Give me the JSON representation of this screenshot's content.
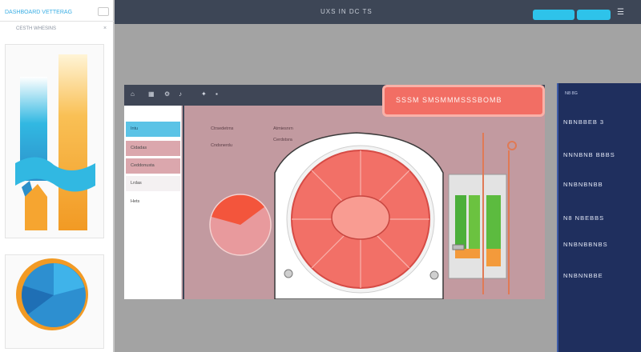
{
  "topbar": {
    "title": "UXS IN DC TS",
    "primary_button": "",
    "secondary_button": ""
  },
  "left_panel": {
    "app_title": "DASHBOARD VETTERAG",
    "subtitle": "CESTH WHESINS",
    "close_glyph": "×"
  },
  "main_window": {
    "alert_text": "SSSM SMSMMMSSSBOMB",
    "sidebar_items": [
      {
        "label": "Intu"
      },
      {
        "label": "Cidadas"
      },
      {
        "label": "Ceddonusta"
      },
      {
        "label": "Lrdas"
      },
      {
        "label": "Hets"
      }
    ],
    "content_lines": [
      "Ctrsedetrns",
      "Atmiesnrn",
      "Cndsnerdu",
      "Cerdstsra"
    ]
  },
  "right_panel": {
    "header": "N8 8G",
    "rows": [
      "NBNBBEB 3",
      "NNNBNB BBBS",
      "NNBNBNBB",
      "N8 NBEBBS",
      "NNBNBBNBS",
      "NNBNNBBE"
    ]
  },
  "colors": {
    "accent": "#2ec3ea",
    "alert": "#f26e64",
    "canvas": "#c29aa0",
    "dark_bar": "#3d4656",
    "right_panel": "#1f2f5e",
    "chart_blue": "#31b8e2",
    "chart_orange": "#f6a530"
  },
  "icons": [
    "home-icon",
    "menu-icon",
    "settings-icon",
    "bell-icon",
    "close-icon",
    "window-icon",
    "star-icon",
    "pin-icon"
  ]
}
